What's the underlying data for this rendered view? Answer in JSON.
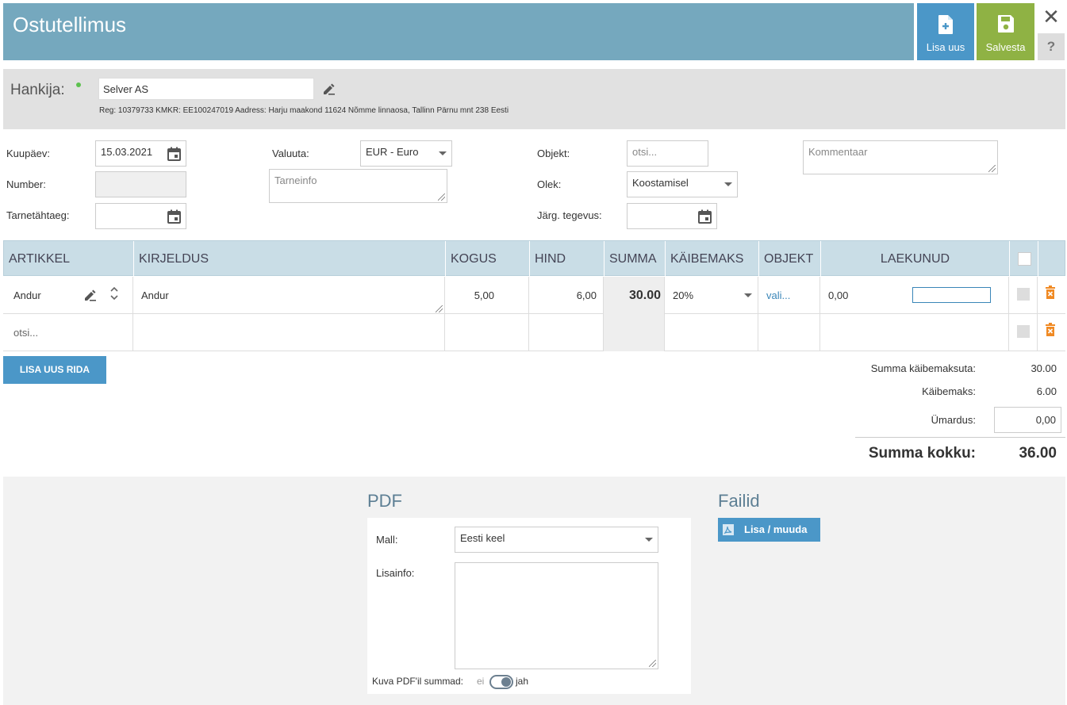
{
  "header": {
    "title": "Ostutellimus",
    "add_new_label": "Lisa uus",
    "save_label": "Salvesta",
    "close_label": "✕",
    "help_label": "?"
  },
  "supplier": {
    "label": "Hankija:",
    "value": "Selver AS",
    "info": "Reg: 10379733 KMKR: EE100247019 Aadress: Harju maakond 11624 Nõmme linnaosa, Tallinn Pärnu mnt 238 Eesti"
  },
  "form": {
    "date_label": "Kuupäev:",
    "date_value": "15.03.2021",
    "number_label": "Number:",
    "number_value": "",
    "delivery_deadline_label": "Tarnetähtaeg:",
    "delivery_deadline_value": "",
    "currency_label": "Valuuta:",
    "currency_value": "EUR - Euro",
    "delivery_info_placeholder": "Tarneinfo",
    "object_label": "Objekt:",
    "object_placeholder": "otsi...",
    "status_label": "Olek:",
    "status_value": "Koostamisel",
    "next_action_label": "Järg. tegevus:",
    "next_action_value": "",
    "comment_placeholder": "Kommentaar"
  },
  "table": {
    "headers": [
      "ARTIKKEL",
      "KIRJELDUS",
      "KOGUS",
      "HIND",
      "SUMMA",
      "KÄIBEMAKS",
      "OBJEKT",
      "LAEKUNUD"
    ],
    "rows": [
      {
        "article": "Andur",
        "description": "Andur",
        "quantity": "5,00",
        "price": "6,00",
        "sum": "30.00",
        "vat": "20%",
        "object": "vali...",
        "received": "0,00"
      }
    ],
    "search_placeholder": "otsi..."
  },
  "add_row_label": "LISA UUS RIDA",
  "totals": {
    "net_label": "Summa käibemaksuta:",
    "net_value": "30.00",
    "vat_label": "Käibemaks:",
    "vat_value": "6.00",
    "rounding_label": "Ümardus:",
    "rounding_value": "0,00",
    "total_label": "Summa kokku:",
    "total_value": "36.00"
  },
  "pdf": {
    "title": "PDF",
    "template_label": "Mall:",
    "template_value": "Eesti keel",
    "extra_info_label": "Lisainfo:",
    "show_sums_label": "Kuva PDF'il summad:",
    "toggle_off_label": "ei",
    "toggle_on_label": "jah",
    "show_sums": true
  },
  "files": {
    "title": "Failid",
    "button_label": "Lisa / muuda"
  }
}
